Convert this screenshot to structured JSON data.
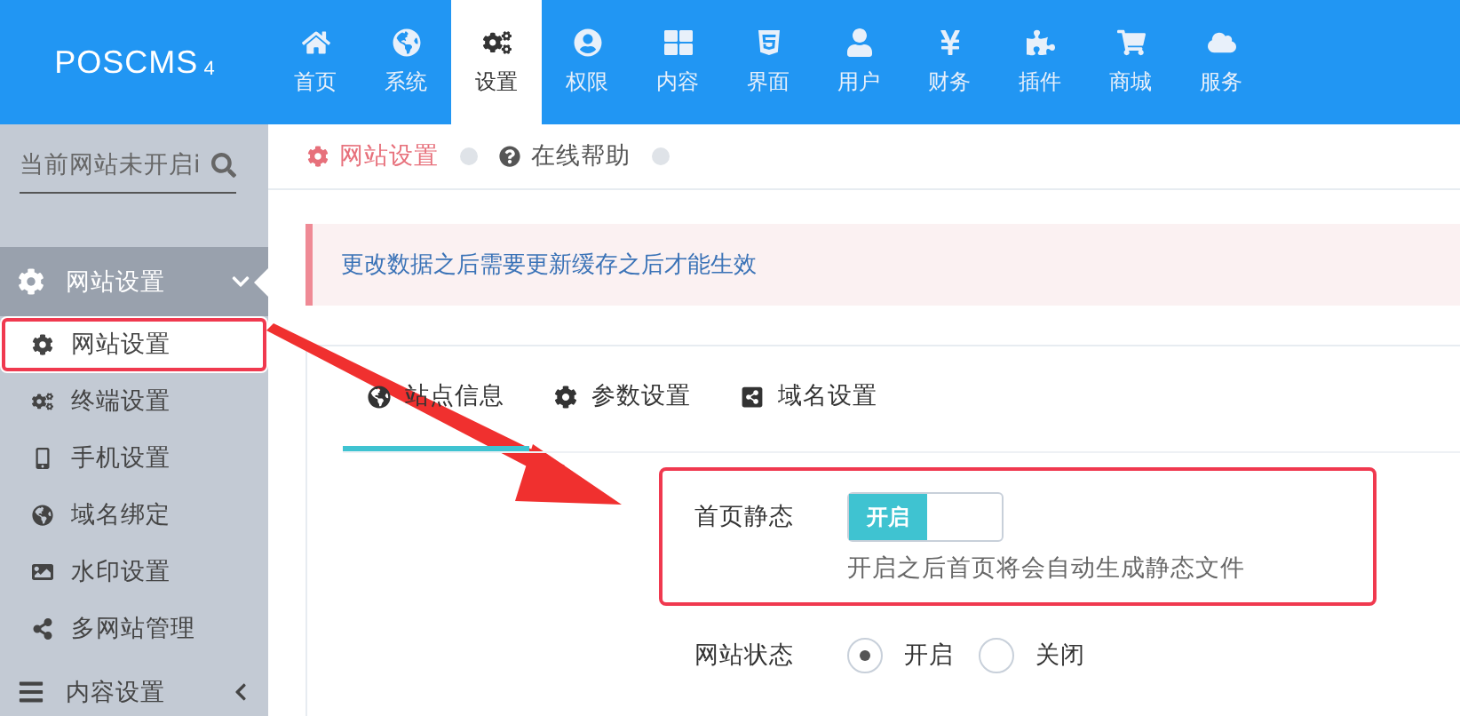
{
  "logo": {
    "name": "POSCMS",
    "version": "4"
  },
  "nav": [
    {
      "label": "首页",
      "selected": false
    },
    {
      "label": "系统",
      "selected": false
    },
    {
      "label": "设置",
      "selected": true
    },
    {
      "label": "权限",
      "selected": false
    },
    {
      "label": "内容",
      "selected": false
    },
    {
      "label": "界面",
      "selected": false
    },
    {
      "label": "用户",
      "selected": false
    },
    {
      "label": "财务",
      "selected": false
    },
    {
      "label": "插件",
      "selected": false
    },
    {
      "label": "商城",
      "selected": false
    },
    {
      "label": "服务",
      "selected": false
    }
  ],
  "sidebar": {
    "search": {
      "value": "当前网站未开启i"
    },
    "groups": [
      {
        "label": "网站设置",
        "expanded": true,
        "children": [
          {
            "label": "网站设置",
            "selected": true,
            "highlighted": true
          },
          {
            "label": "终端设置",
            "selected": false,
            "highlighted": false
          },
          {
            "label": "手机设置",
            "selected": false,
            "highlighted": false
          },
          {
            "label": "域名绑定",
            "selected": false,
            "highlighted": false
          },
          {
            "label": "水印设置",
            "selected": false,
            "highlighted": false
          },
          {
            "label": "多网站管理",
            "selected": false,
            "highlighted": false
          }
        ]
      },
      {
        "label": "内容设置",
        "expanded": false
      }
    ]
  },
  "breadcrumb": [
    {
      "label": "网站设置",
      "selected": true
    },
    {
      "label": "在线帮助",
      "selected": false
    }
  ],
  "alert": "更改数据之后需要更新缓存之后才能生效",
  "tabs": [
    {
      "label": "站点信息",
      "selected": true
    },
    {
      "label": "参数设置",
      "selected": false
    },
    {
      "label": "域名设置",
      "selected": false
    }
  ],
  "form": [
    {
      "kind": "toggle",
      "label": "首页静态",
      "on": true,
      "toggle_text": "开启",
      "help": "开启之后首页将会自动生成静态文件",
      "highlighted": true
    },
    {
      "kind": "radio",
      "label": "网站状态",
      "options": [
        {
          "label": "开启",
          "selected": true
        },
        {
          "label": "关闭",
          "selected": false
        }
      ]
    }
  ]
}
